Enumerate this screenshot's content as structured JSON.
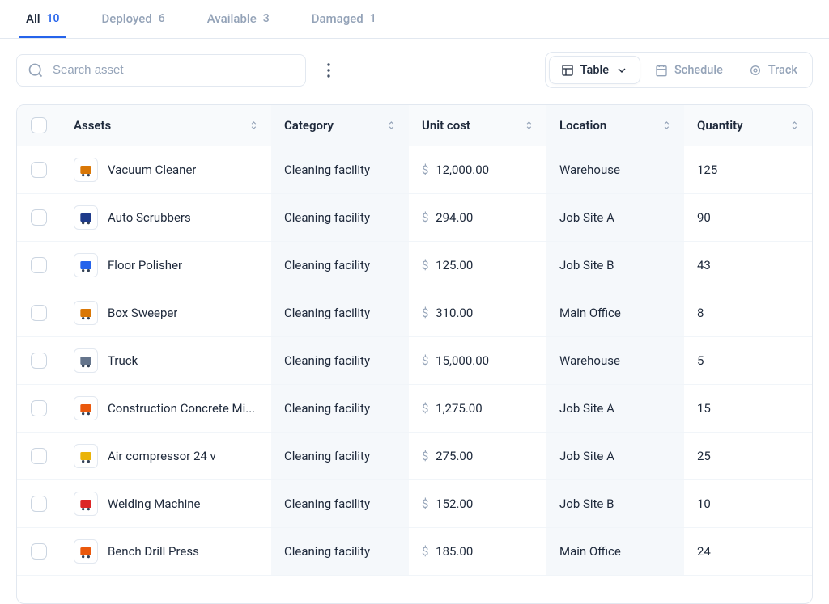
{
  "tabs": [
    {
      "label": "All",
      "count": "10",
      "active": true
    },
    {
      "label": "Deployed",
      "count": "6",
      "active": false
    },
    {
      "label": "Available",
      "count": "3",
      "active": false
    },
    {
      "label": "Damaged",
      "count": "1",
      "active": false
    }
  ],
  "search": {
    "placeholder": "Search asset"
  },
  "view_switcher": {
    "table": "Table",
    "schedule": "Schedule",
    "track": "Track"
  },
  "columns": {
    "assets": "Assets",
    "category": "Category",
    "unit_cost": "Unit cost",
    "location": "Location",
    "quantity": "Quantity"
  },
  "currency_symbol": "$",
  "rows": [
    {
      "name": "Vacuum Cleaner",
      "category": "Cleaning facility",
      "cost": "12,000.00",
      "location": "Warehouse",
      "quantity": "125",
      "icon_color": "#d97706"
    },
    {
      "name": "Auto Scrubbers",
      "category": "Cleaning facility",
      "cost": "294.00",
      "location": "Job Site A",
      "quantity": "90",
      "icon_color": "#1e3a8a"
    },
    {
      "name": "Floor Polisher",
      "category": "Cleaning facility",
      "cost": "125.00",
      "location": "Job Site B",
      "quantity": "43",
      "icon_color": "#2563eb"
    },
    {
      "name": "Box Sweeper",
      "category": "Cleaning facility",
      "cost": "310.00",
      "location": "Main Office",
      "quantity": "8",
      "icon_color": "#d97706"
    },
    {
      "name": "Truck",
      "category": "Cleaning facility",
      "cost": "15,000.00",
      "location": "Warehouse",
      "quantity": "5",
      "icon_color": "#64748b"
    },
    {
      "name": "Construction Concrete Mi...",
      "category": "Cleaning facility",
      "cost": "1,275.00",
      "location": "Job Site A",
      "quantity": "15",
      "icon_color": "#ea580c"
    },
    {
      "name": "Air compressor 24 v",
      "category": "Cleaning facility",
      "cost": "275.00",
      "location": "Job Site A",
      "quantity": "25",
      "icon_color": "#eab308"
    },
    {
      "name": "Welding Machine",
      "category": "Cleaning facility",
      "cost": "152.00",
      "location": "Job Site B",
      "quantity": "10",
      "icon_color": "#dc2626"
    },
    {
      "name": "Bench Drill Press",
      "category": "Cleaning facility",
      "cost": "185.00",
      "location": "Main Office",
      "quantity": "24",
      "icon_color": "#ea580c"
    }
  ]
}
